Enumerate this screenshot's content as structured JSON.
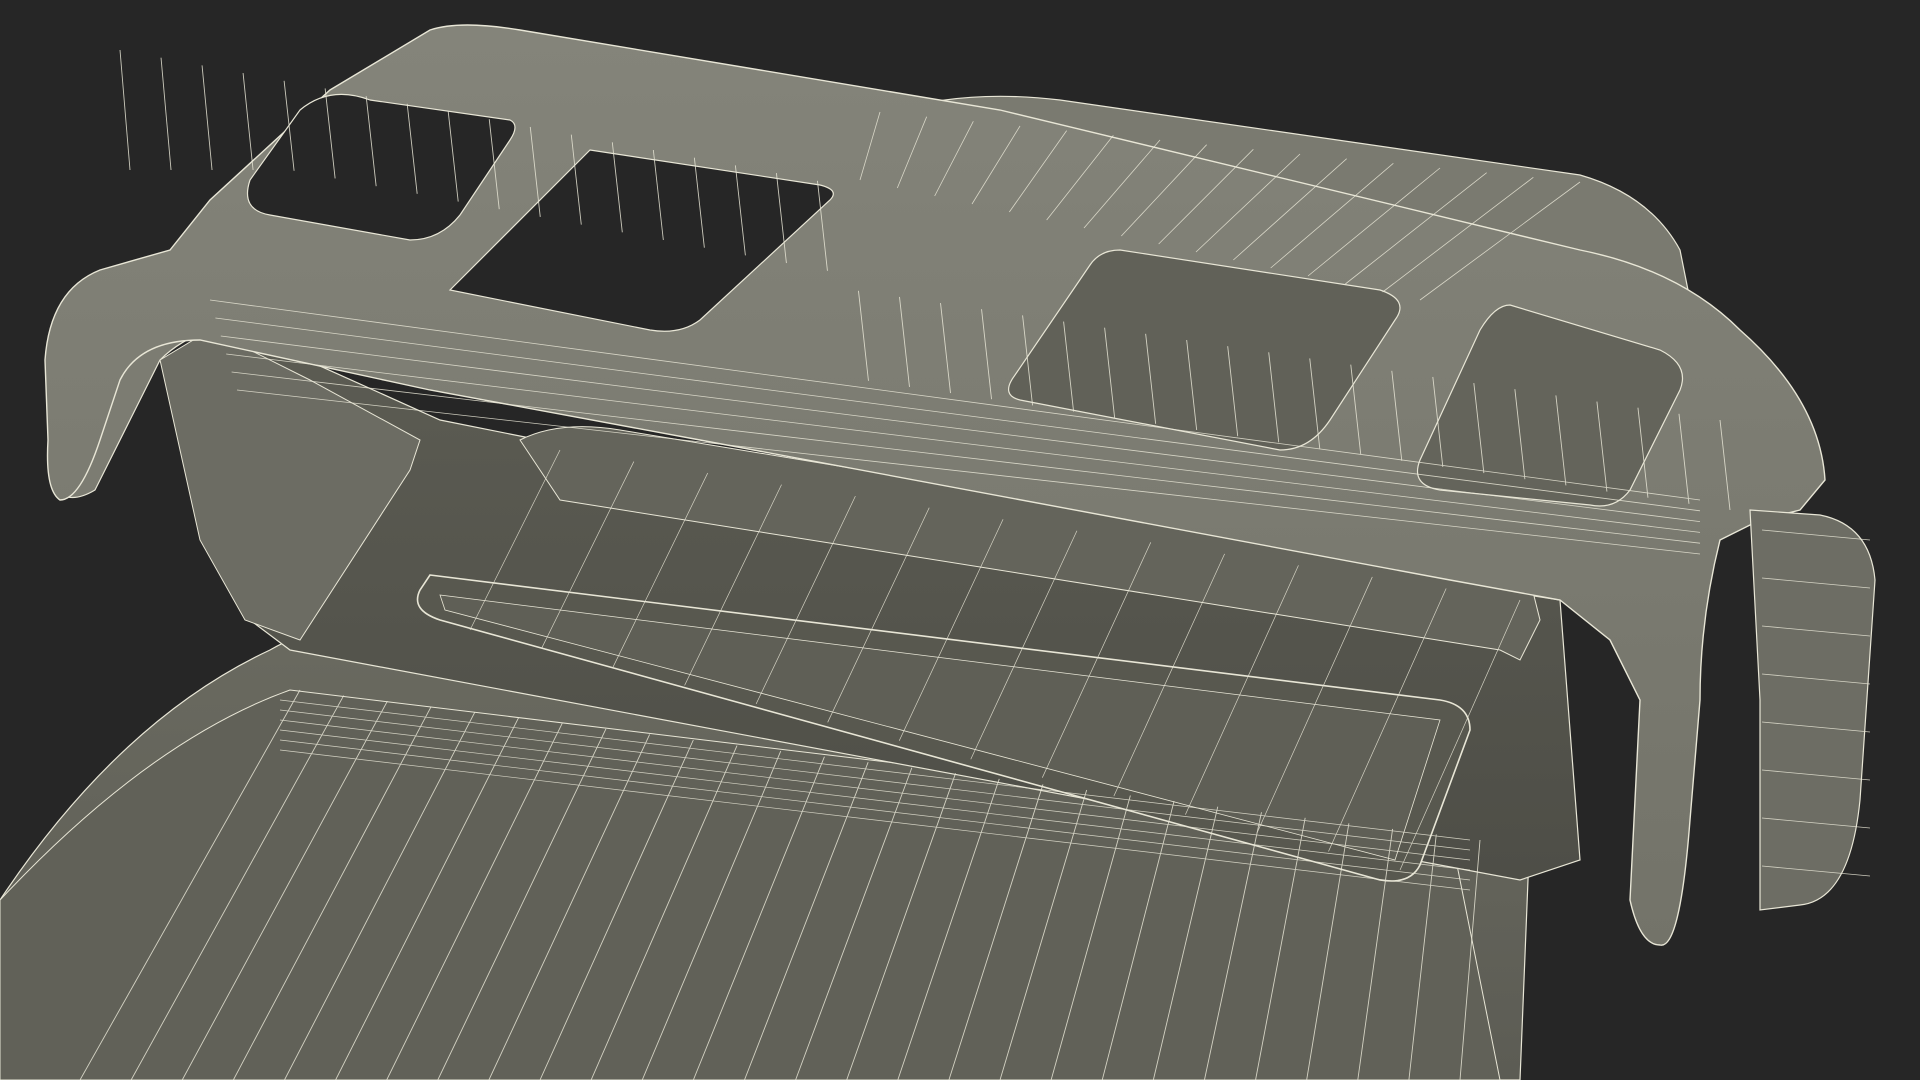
{
  "scene": {
    "subject": "wireframe-3d-model",
    "colors": {
      "background": "#262626",
      "surface_light": "#7d7d71",
      "surface_mid": "#6e6e63",
      "surface_dark": "#56564d",
      "surface_shadow": "#3f3f39",
      "wire": "#e8e6d6"
    }
  }
}
